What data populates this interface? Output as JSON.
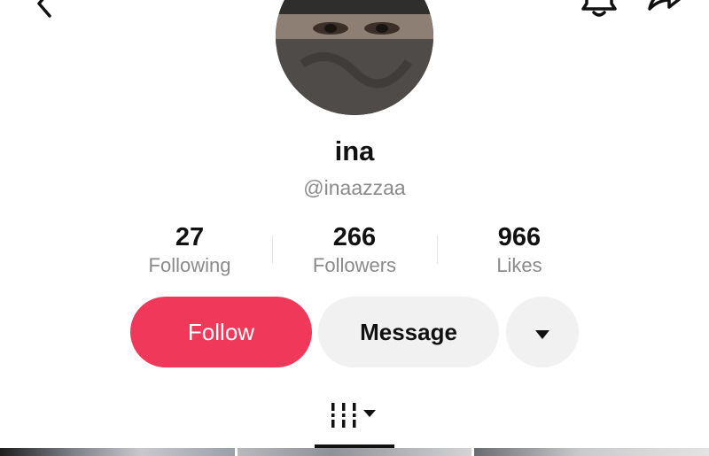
{
  "profile": {
    "display_name": "ina",
    "handle": "@inaazzaa"
  },
  "stats": [
    {
      "value": "27",
      "label": "Following"
    },
    {
      "value": "266",
      "label": "Followers"
    },
    {
      "value": "966",
      "label": "Likes"
    }
  ],
  "actions": {
    "follow_label": "Follow",
    "message_label": "Message"
  },
  "icons": {
    "back": "chevron-left-icon",
    "notifications": "bell-icon",
    "share": "share-arrow-icon",
    "more": "caret-down-icon",
    "videos_tab": "video-grid-icon"
  },
  "colors": {
    "follow_button": "#f0385b",
    "secondary_button": "#f1f1f2",
    "muted_text": "#8a8a8a"
  }
}
